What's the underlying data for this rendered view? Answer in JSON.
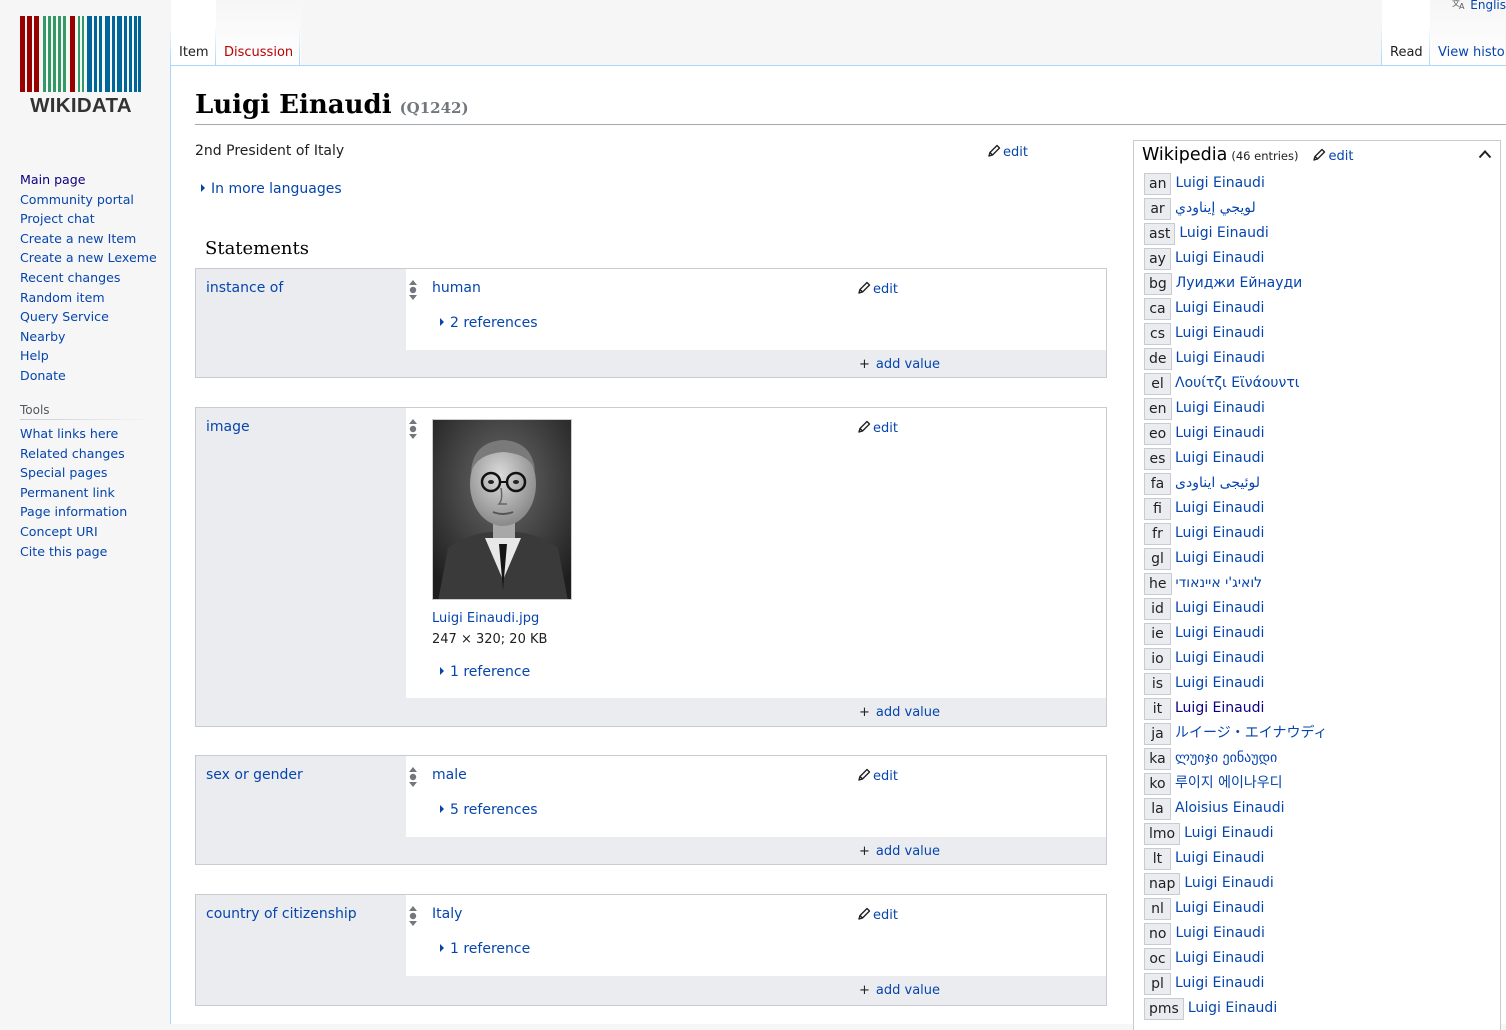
{
  "sidebar": {
    "logo_text": "WIKIDATA",
    "navigation": [
      "Main page",
      "Community portal",
      "Project chat",
      "Create a new Item",
      "Create a new Lexeme",
      "Recent changes",
      "Random item",
      "Query Service",
      "Nearby",
      "Help",
      "Donate"
    ],
    "tools_heading": "Tools",
    "tools": [
      "What links here",
      "Related changes",
      "Special pages",
      "Permanent link",
      "Page information",
      "Concept URI",
      "Cite this page"
    ]
  },
  "header": {
    "tabs_left": [
      "Item",
      "Discussion"
    ],
    "tabs_right": [
      "Read",
      "View histo"
    ],
    "language_link": "Englis"
  },
  "item": {
    "label": "Luigi Einaudi",
    "qid": "(Q1242)",
    "description": "2nd President of Italy",
    "more_languages": "In more languages",
    "edit_label": "edit"
  },
  "statements": {
    "heading": "Statements",
    "add_value_label": "add value",
    "groups": [
      {
        "property": "instance of",
        "value": "human",
        "references": "2 references"
      },
      {
        "property": "image",
        "file_name": "Luigi Einaudi.jpg",
        "file_meta": "247 × 320; 20 KB",
        "references": "1 reference"
      },
      {
        "property": "sex or gender",
        "value": "male",
        "references": "5 references"
      },
      {
        "property": "country of citizenship",
        "value": "Italy",
        "references": "1 reference"
      }
    ]
  },
  "sitelinks": {
    "title": "Wikipedia",
    "count": "(46 entries)",
    "edit_label": "edit",
    "entries": [
      {
        "code": "an",
        "title": "Luigi Einaudi"
      },
      {
        "code": "ar",
        "title": "لويجي إيناودي"
      },
      {
        "code": "ast",
        "title": "Luigi Einaudi"
      },
      {
        "code": "ay",
        "title": "Luigi Einaudi"
      },
      {
        "code": "bg",
        "title": "Луиджи Ейнауди"
      },
      {
        "code": "ca",
        "title": "Luigi Einaudi"
      },
      {
        "code": "cs",
        "title": "Luigi Einaudi"
      },
      {
        "code": "de",
        "title": "Luigi Einaudi"
      },
      {
        "code": "el",
        "title": "Λουίτζι Εϊνάουντι"
      },
      {
        "code": "en",
        "title": "Luigi Einaudi"
      },
      {
        "code": "eo",
        "title": "Luigi Einaudi"
      },
      {
        "code": "es",
        "title": "Luigi Einaudi"
      },
      {
        "code": "fa",
        "title": "لوئیجی ایناودی"
      },
      {
        "code": "fi",
        "title": "Luigi Einaudi"
      },
      {
        "code": "fr",
        "title": "Luigi Einaudi"
      },
      {
        "code": "gl",
        "title": "Luigi Einaudi"
      },
      {
        "code": "he",
        "title": "לואיג'י איינאודי"
      },
      {
        "code": "id",
        "title": "Luigi Einaudi"
      },
      {
        "code": "ie",
        "title": "Luigi Einaudi"
      },
      {
        "code": "io",
        "title": "Luigi Einaudi"
      },
      {
        "code": "is",
        "title": "Luigi Einaudi"
      },
      {
        "code": "it",
        "title": "Luigi Einaudi",
        "visited": true
      },
      {
        "code": "ja",
        "title": "ルイージ・エイナウディ"
      },
      {
        "code": "ka",
        "title": "ლუიჯი ეინაუდი"
      },
      {
        "code": "ko",
        "title": "루이지 에이나우디"
      },
      {
        "code": "la",
        "title": "Aloisius Einaudi"
      },
      {
        "code": "lmo",
        "title": "Luigi Einaudi"
      },
      {
        "code": "lt",
        "title": "Luigi Einaudi"
      },
      {
        "code": "nap",
        "title": "Luigi Einaudi"
      },
      {
        "code": "nl",
        "title": "Luigi Einaudi"
      },
      {
        "code": "no",
        "title": "Luigi Einaudi"
      },
      {
        "code": "oc",
        "title": "Luigi Einaudi"
      },
      {
        "code": "pl",
        "title": "Luigi Einaudi"
      },
      {
        "code": "pms",
        "title": "Luigi Einaudi"
      }
    ]
  },
  "colors": {
    "link": "#0645ad",
    "visited_link": "#0b0080",
    "new_link": "#ba0000",
    "logo_bars": [
      "#990000",
      "#339966",
      "#006699"
    ]
  }
}
